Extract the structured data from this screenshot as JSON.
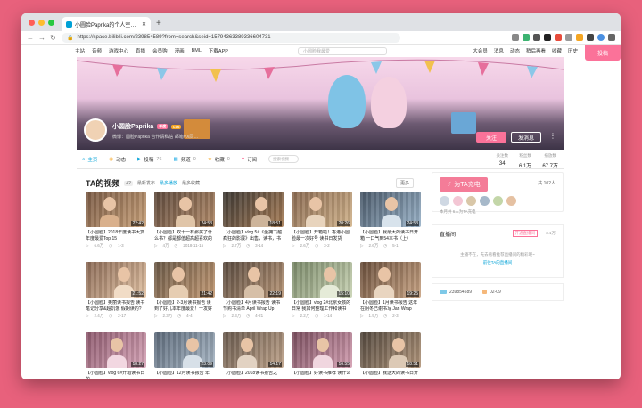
{
  "browser": {
    "tab_title": "小圆脸Paprika的个人空间 - 哔哩…",
    "url": "https://space.bilibili.com/239854589?from=search&seid=15794363389336604731"
  },
  "topnav": {
    "items": [
      "主站",
      "音频",
      "游戏中心",
      "直播",
      "会员购",
      "漫画",
      "BML",
      "下载APP"
    ],
    "search_placeholder": "小圆脸我最爱",
    "right_items": [
      "大会员",
      "消息",
      "动态",
      "稍后再看",
      "收藏",
      "历史"
    ],
    "upload": "投稿"
  },
  "profile": {
    "name": "小圆脸Paprika",
    "level": "LV6",
    "vip": "年度",
    "sign": "微博：圆脸Paprika 合作请私信 邮箱VX同…",
    "follow_label": "关注",
    "message_label": "发消息"
  },
  "space_nav": {
    "items": [
      {
        "label": "主页",
        "count": ""
      },
      {
        "label": "动态",
        "count": ""
      },
      {
        "label": "投稿",
        "count": "76"
      },
      {
        "label": "频道",
        "count": "0"
      },
      {
        "label": "收藏",
        "count": "0"
      },
      {
        "label": "订阅",
        "count": ""
      }
    ],
    "search_placeholder": "搜索视频",
    "stats": [
      {
        "label": "关注数",
        "value": "34"
      },
      {
        "label": "粉丝数",
        "value": "6.1万"
      },
      {
        "label": "播放数",
        "value": "67.7万"
      }
    ]
  },
  "videos": {
    "title": "TA的视频",
    "count": "42",
    "sort": [
      "最新发布",
      "最多播放",
      "最多收藏"
    ],
    "more": "更多",
    "items": [
      {
        "title": "【小圆脸】2018年度读书大赏 年度最爱Top 15",
        "duration": "22:42",
        "views": "6.6万",
        "date": "1-3"
      },
      {
        "title": "【小圆脸】双十一有那买了什么书？都是都值超高超喜欢的",
        "duration": "24:53",
        "views": "4万",
        "date": "2018-11-15"
      },
      {
        "title": "【小圆脸】vlog 5#《坐拥飞越疯狂的影展》出售，读书，书店",
        "duration": "18:51",
        "views": "2.7万",
        "date": "3-14"
      },
      {
        "title": "【小圆脸】开箱啦！香港小圆脸最一次好号 读书日发货",
        "duration": "20:26",
        "views": "2.6万",
        "date": "3-2"
      },
      {
        "title": "【小圆脸】我最大的读书日开箱 一口气到54本书（上）",
        "duration": "24:53",
        "views": "2.6万",
        "date": "5-1"
      },
      {
        "title": "【小圆脸】奥丽读书报告 读书笔记分享&超饥饿 假期读的?",
        "duration": "21:52",
        "views": "2.4万",
        "date": "2-17"
      },
      {
        "title": "【小圆脸】2-3月读书报告 读到了好几本年度最爱！一发好",
        "duration": "21:42",
        "views": "2.3万",
        "date": "4-4"
      },
      {
        "title": "【小圆脸】4月读书报告 读书节购书清单 April Wrap Up",
        "duration": "22:19",
        "views": "2.3万",
        "date": "4-21"
      },
      {
        "title": "【小圆脸】vlog 2#北京女孩的日常 我如何整理工作和读书",
        "duration": "15:10",
        "views": "2.2万",
        "date": "1-14"
      },
      {
        "title": "【小圆脸】1月读书报告 这年在阴冬己谢书写 Jan Wrap",
        "duration": "19:25",
        "views": "1.9万",
        "date": "2-3"
      },
      {
        "title": "【小圆脸】vlog 6#开箱读书日的",
        "duration": "18:27",
        "views": "1.8万",
        "date": "3-20"
      },
      {
        "title": "【小圆脸】12月读书报告 年",
        "duration": "23:09",
        "views": "1.8万",
        "date": "1-8"
      },
      {
        "title": "【小圆脸】2018读书报告之",
        "duration": "14:17",
        "views": "1.7万",
        "date": "1-1"
      },
      {
        "title": "【小圆脸】好读书推荐 读什么",
        "duration": "16:55",
        "views": "1.7万",
        "date": "3-7"
      },
      {
        "title": "【小圆脸】我送大的读书日开",
        "duration": "18:51",
        "views": "1.6万",
        "date": "5-4"
      }
    ]
  },
  "sidebar": {
    "charge_label": "为TA充电",
    "charge_count": "共 102人",
    "charge_note": "本月共 6人为TA充电",
    "live_title": "直播间",
    "live_btn": "开通直播间",
    "live_btn2": "3.1万",
    "live_text": "主播不在，先去看看推荐直播间的精彩吧~",
    "live_link": "前往TA的直播间",
    "uid": "239854589",
    "birthday": "02-09"
  }
}
